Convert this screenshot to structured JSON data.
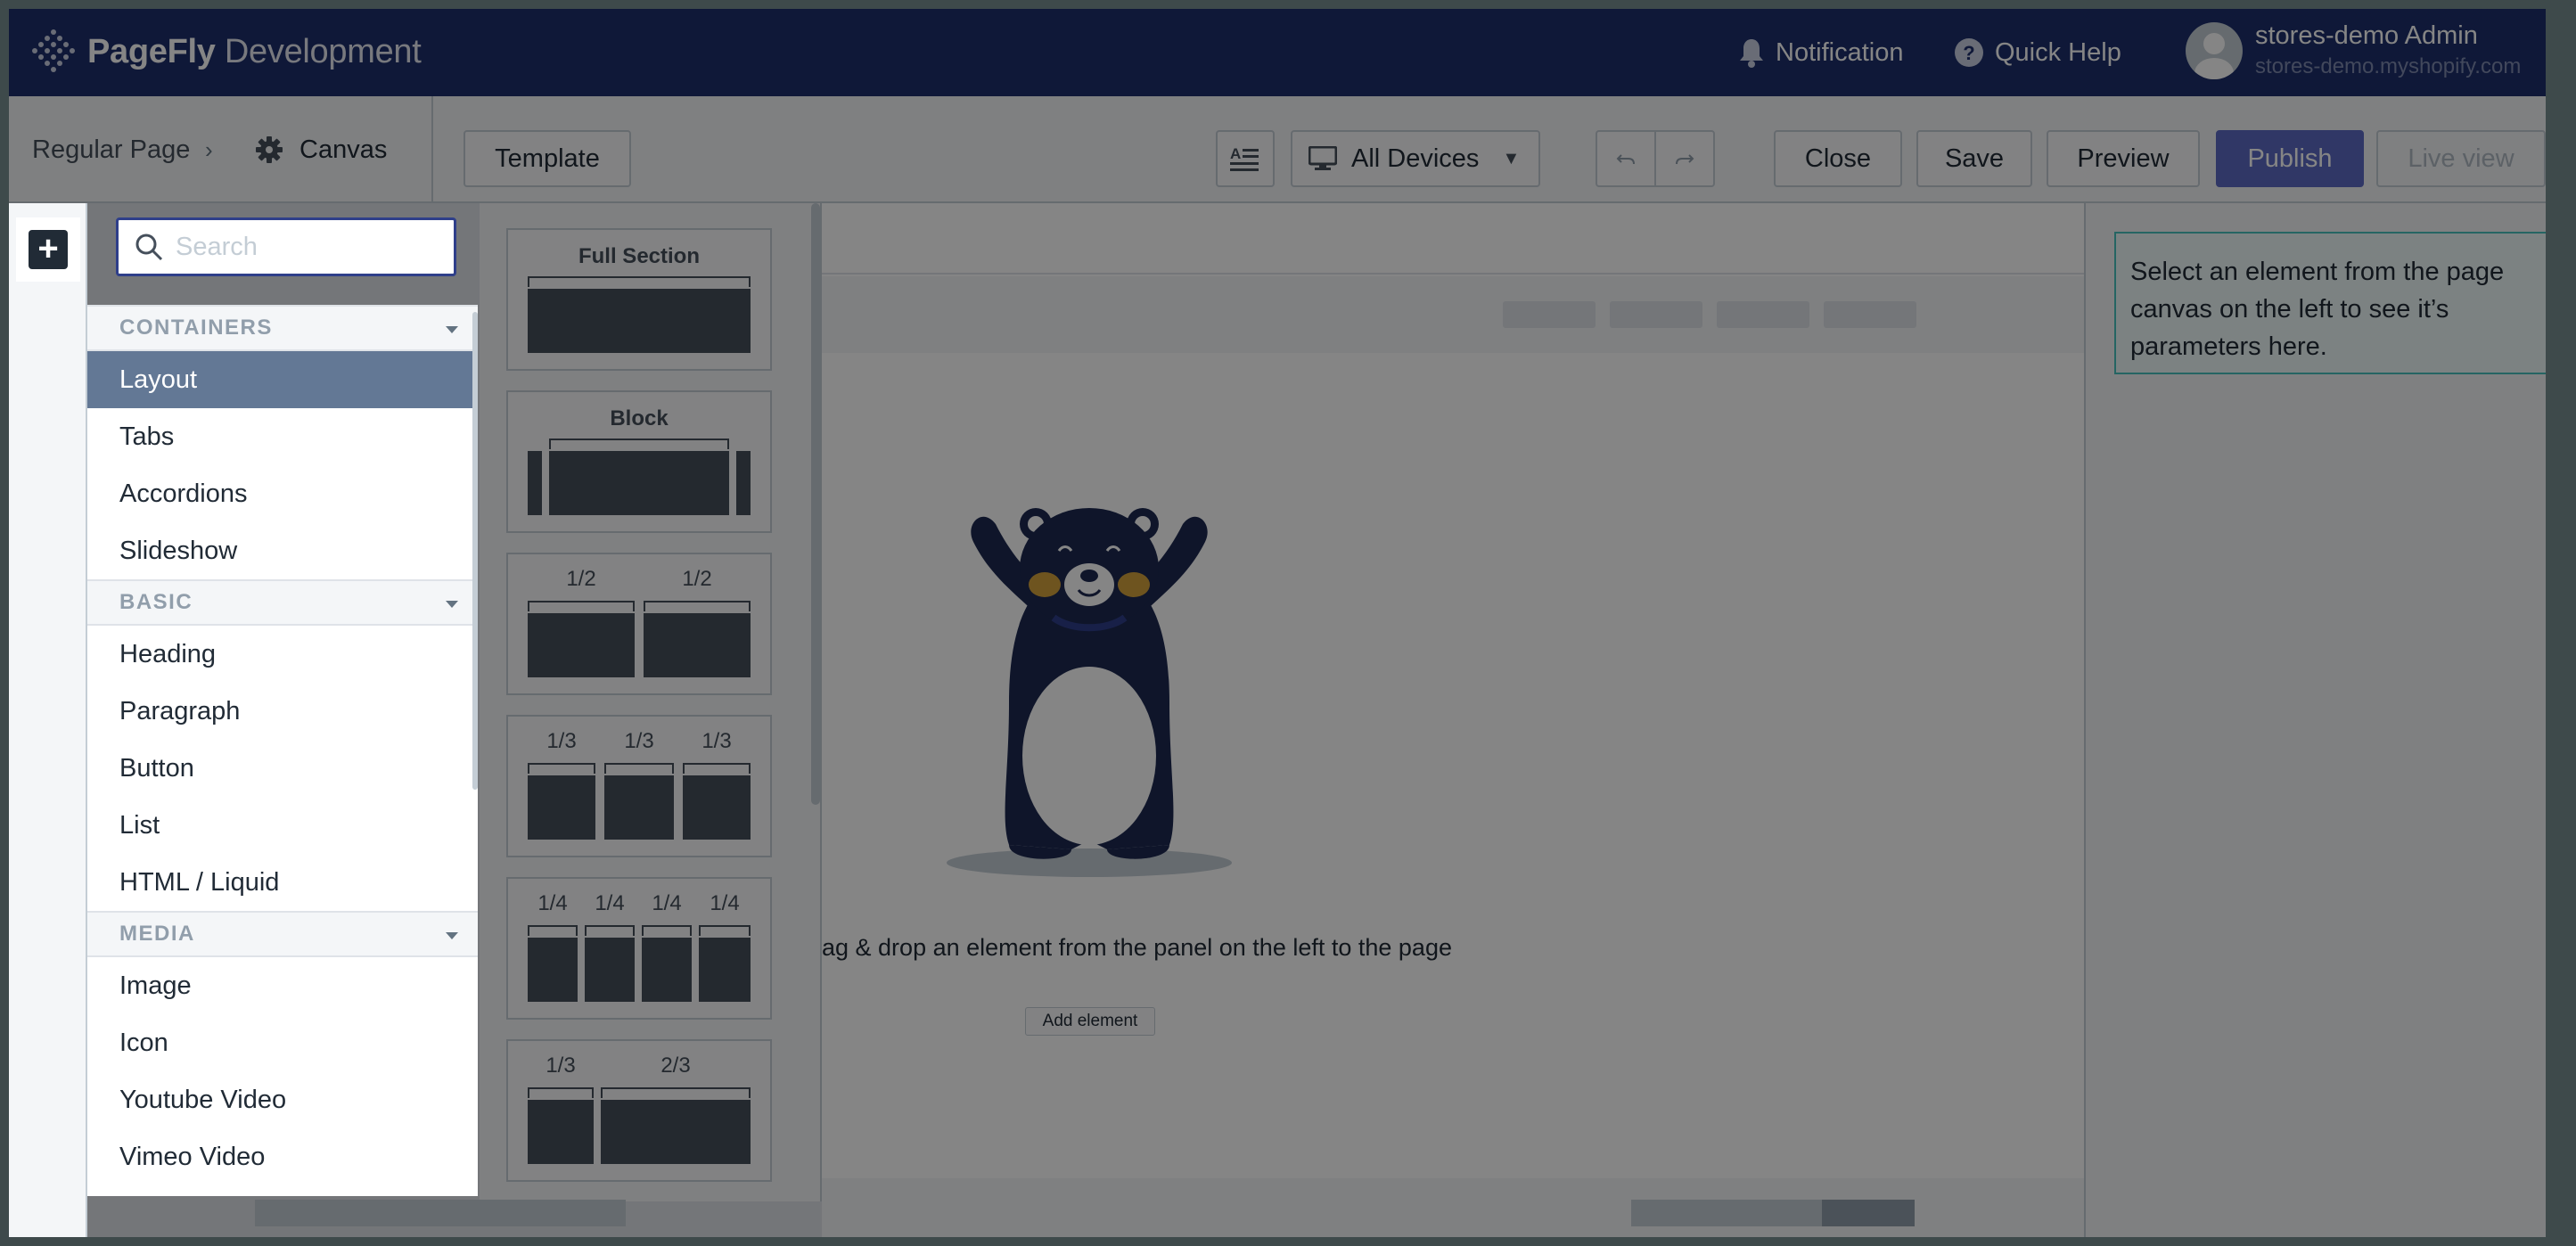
{
  "topbar": {
    "logo_bold": "PageFly",
    "logo_light": "Development",
    "notification_label": "Notification",
    "quick_help_label": "Quick Help",
    "user_name": "stores-demo Admin",
    "user_domain": "stores-demo.myshopify.com"
  },
  "toolbar": {
    "breadcrumb_page": "Regular Page",
    "breadcrumb_sep": "›",
    "breadcrumb_current": "Canvas",
    "template_label": "Template",
    "devices_label": "All Devices",
    "close_label": "Close",
    "save_label": "Save",
    "preview_label": "Preview",
    "publish_label": "Publish",
    "live_view_label": "Live view"
  },
  "search": {
    "placeholder": "Search"
  },
  "elements": {
    "containers": {
      "header": "CONTAINERS",
      "items": [
        "Layout",
        "Tabs",
        "Accordions",
        "Slideshow"
      ]
    },
    "basic": {
      "header": "BASIC",
      "items": [
        "Heading",
        "Paragraph",
        "Button",
        "List",
        "HTML / Liquid"
      ]
    },
    "media": {
      "header": "MEDIA",
      "items": [
        "Image",
        "Icon",
        "Youtube Video",
        "Vimeo Video"
      ]
    }
  },
  "presets": {
    "full": "Full Section",
    "block": "Block",
    "half": "1/2",
    "third": "1/3",
    "quarter": "1/4",
    "two_thirds": "2/3"
  },
  "canvas": {
    "drag_text": "ag & drop an element from the panel on the left to the page",
    "add_element_label": "Add element"
  },
  "right_panel": {
    "info": "Select an element from the page canvas on the left to see it’s parameters here."
  },
  "colors": {
    "topbar": "#1d2f6b",
    "publish": "#5c6ac4",
    "active_item": "#637895",
    "bear_body": "#1d2a52",
    "bear_cheek": "#d4a23c",
    "info_border": "#47c1bf"
  }
}
